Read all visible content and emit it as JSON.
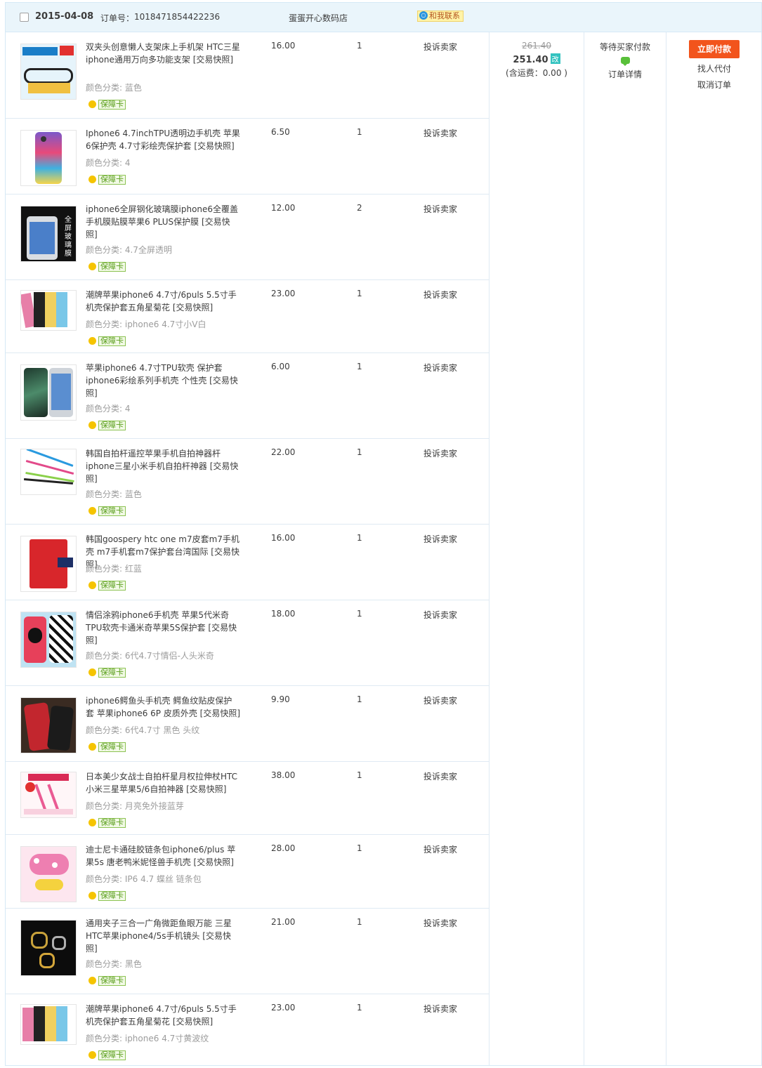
{
  "header": {
    "date": "2015-04-08",
    "order_label": "订单号：",
    "order_number": "1018471854422236",
    "shop": "蛋蛋开心数码店",
    "contact": "和我联系"
  },
  "order_summary": {
    "original_price": "261.40",
    "real_price": "251.40",
    "modify_mark": "改",
    "shipping": "(含运费：0.00 )"
  },
  "status": {
    "text": "等待买家付款",
    "detail": "订单详情"
  },
  "operations": {
    "pay": "立即付款",
    "proxy": "找人代付",
    "cancel": "取消订单"
  },
  "badge_label": "保障卡",
  "complain_label": "投诉卖家",
  "items": [
    {
      "title": "双夹头创意懒人支架床上手机架 HTC三星iphone通用万向多功能支架 [交易快照]",
      "sku": "颜色分类: 蓝色",
      "price": "16.00",
      "qty": "1"
    },
    {
      "title": "Iphone6 4.7inchTPU透明边手机壳 苹果6保护壳 4.7寸彩绘壳保护套 [交易快照]",
      "sku": "颜色分类: 4",
      "price": "6.50",
      "qty": "1"
    },
    {
      "title": "iphone6全屏钢化玻璃膜iphone6全覆盖手机膜贴膜苹果6 PLUS保护膜 [交易快照]",
      "sku": "颜色分类: 4.7全屏透明",
      "price": "12.00",
      "qty": "2"
    },
    {
      "title": "潮牌苹果iphone6 4.7寸/6puls 5.5寸手机壳保护套五角星菊花 [交易快照]",
      "sku": "颜色分类: iphone6 4.7寸小V白",
      "price": "23.00",
      "qty": "1"
    },
    {
      "title": "苹果iphone6 4.7寸TPU软壳 保护套 iphone6彩绘系列手机壳 个性壳 [交易快照]",
      "sku": "颜色分类: 4",
      "price": "6.00",
      "qty": "1"
    },
    {
      "title": "韩国自拍杆遥控苹果手机自拍神器杆 iphone三星小米手机自拍杆神器 [交易快照]",
      "sku": "颜色分类: 蓝色",
      "price": "22.00",
      "qty": "1"
    },
    {
      "title": "韩国goospery htc one m7皮套m7手机壳 m7手机套m7保护套台湾国际 [交易快照]",
      "sku": "颜色分类: 红蓝",
      "price": "16.00",
      "qty": "1"
    },
    {
      "title": "情侣涂鸦iphone6手机壳 苹果5代米奇TPU软壳卡通米奇苹果5S保护套 [交易快照]",
      "sku": "颜色分类: 6代4.7寸情侣-人头米奇",
      "price": "18.00",
      "qty": "1"
    },
    {
      "title": "iphone6鳄鱼头手机壳 鳄鱼纹贴皮保护套 苹果iphone6 6P 皮质外壳 [交易快照]",
      "sku": "颜色分类: 6代4.7寸 黑色 头纹",
      "price": "9.90",
      "qty": "1"
    },
    {
      "title": "日本美少女战士自拍杆星月权拉伸杖HTC小米三星苹果5/6自拍神器 [交易快照]",
      "sku": "颜色分类: 月亮免外接蓝芽",
      "price": "38.00",
      "qty": "1"
    },
    {
      "title": "迪士尼卡通硅胶链条包iphone6/plus 苹果5s 唐老鸭米妮怪兽手机壳 [交易快照]",
      "sku": "颜色分类: IP6 4.7 蝶丝 链条包",
      "price": "28.00",
      "qty": "1"
    },
    {
      "title": "通用夹子三合一广角微距鱼眼万能 三星HTC苹果iphone4/5s手机镜头 [交易快照]",
      "sku": "颜色分类: 黑色",
      "price": "21.00",
      "qty": "1"
    },
    {
      "title": "潮牌苹果iphone6 4.7寸/6puls 5.5寸手机壳保护套五角星菊花 [交易快照]",
      "sku": "颜色分类: iphone6 4.7寸黄波纹",
      "price": "23.00",
      "qty": "1"
    }
  ]
}
